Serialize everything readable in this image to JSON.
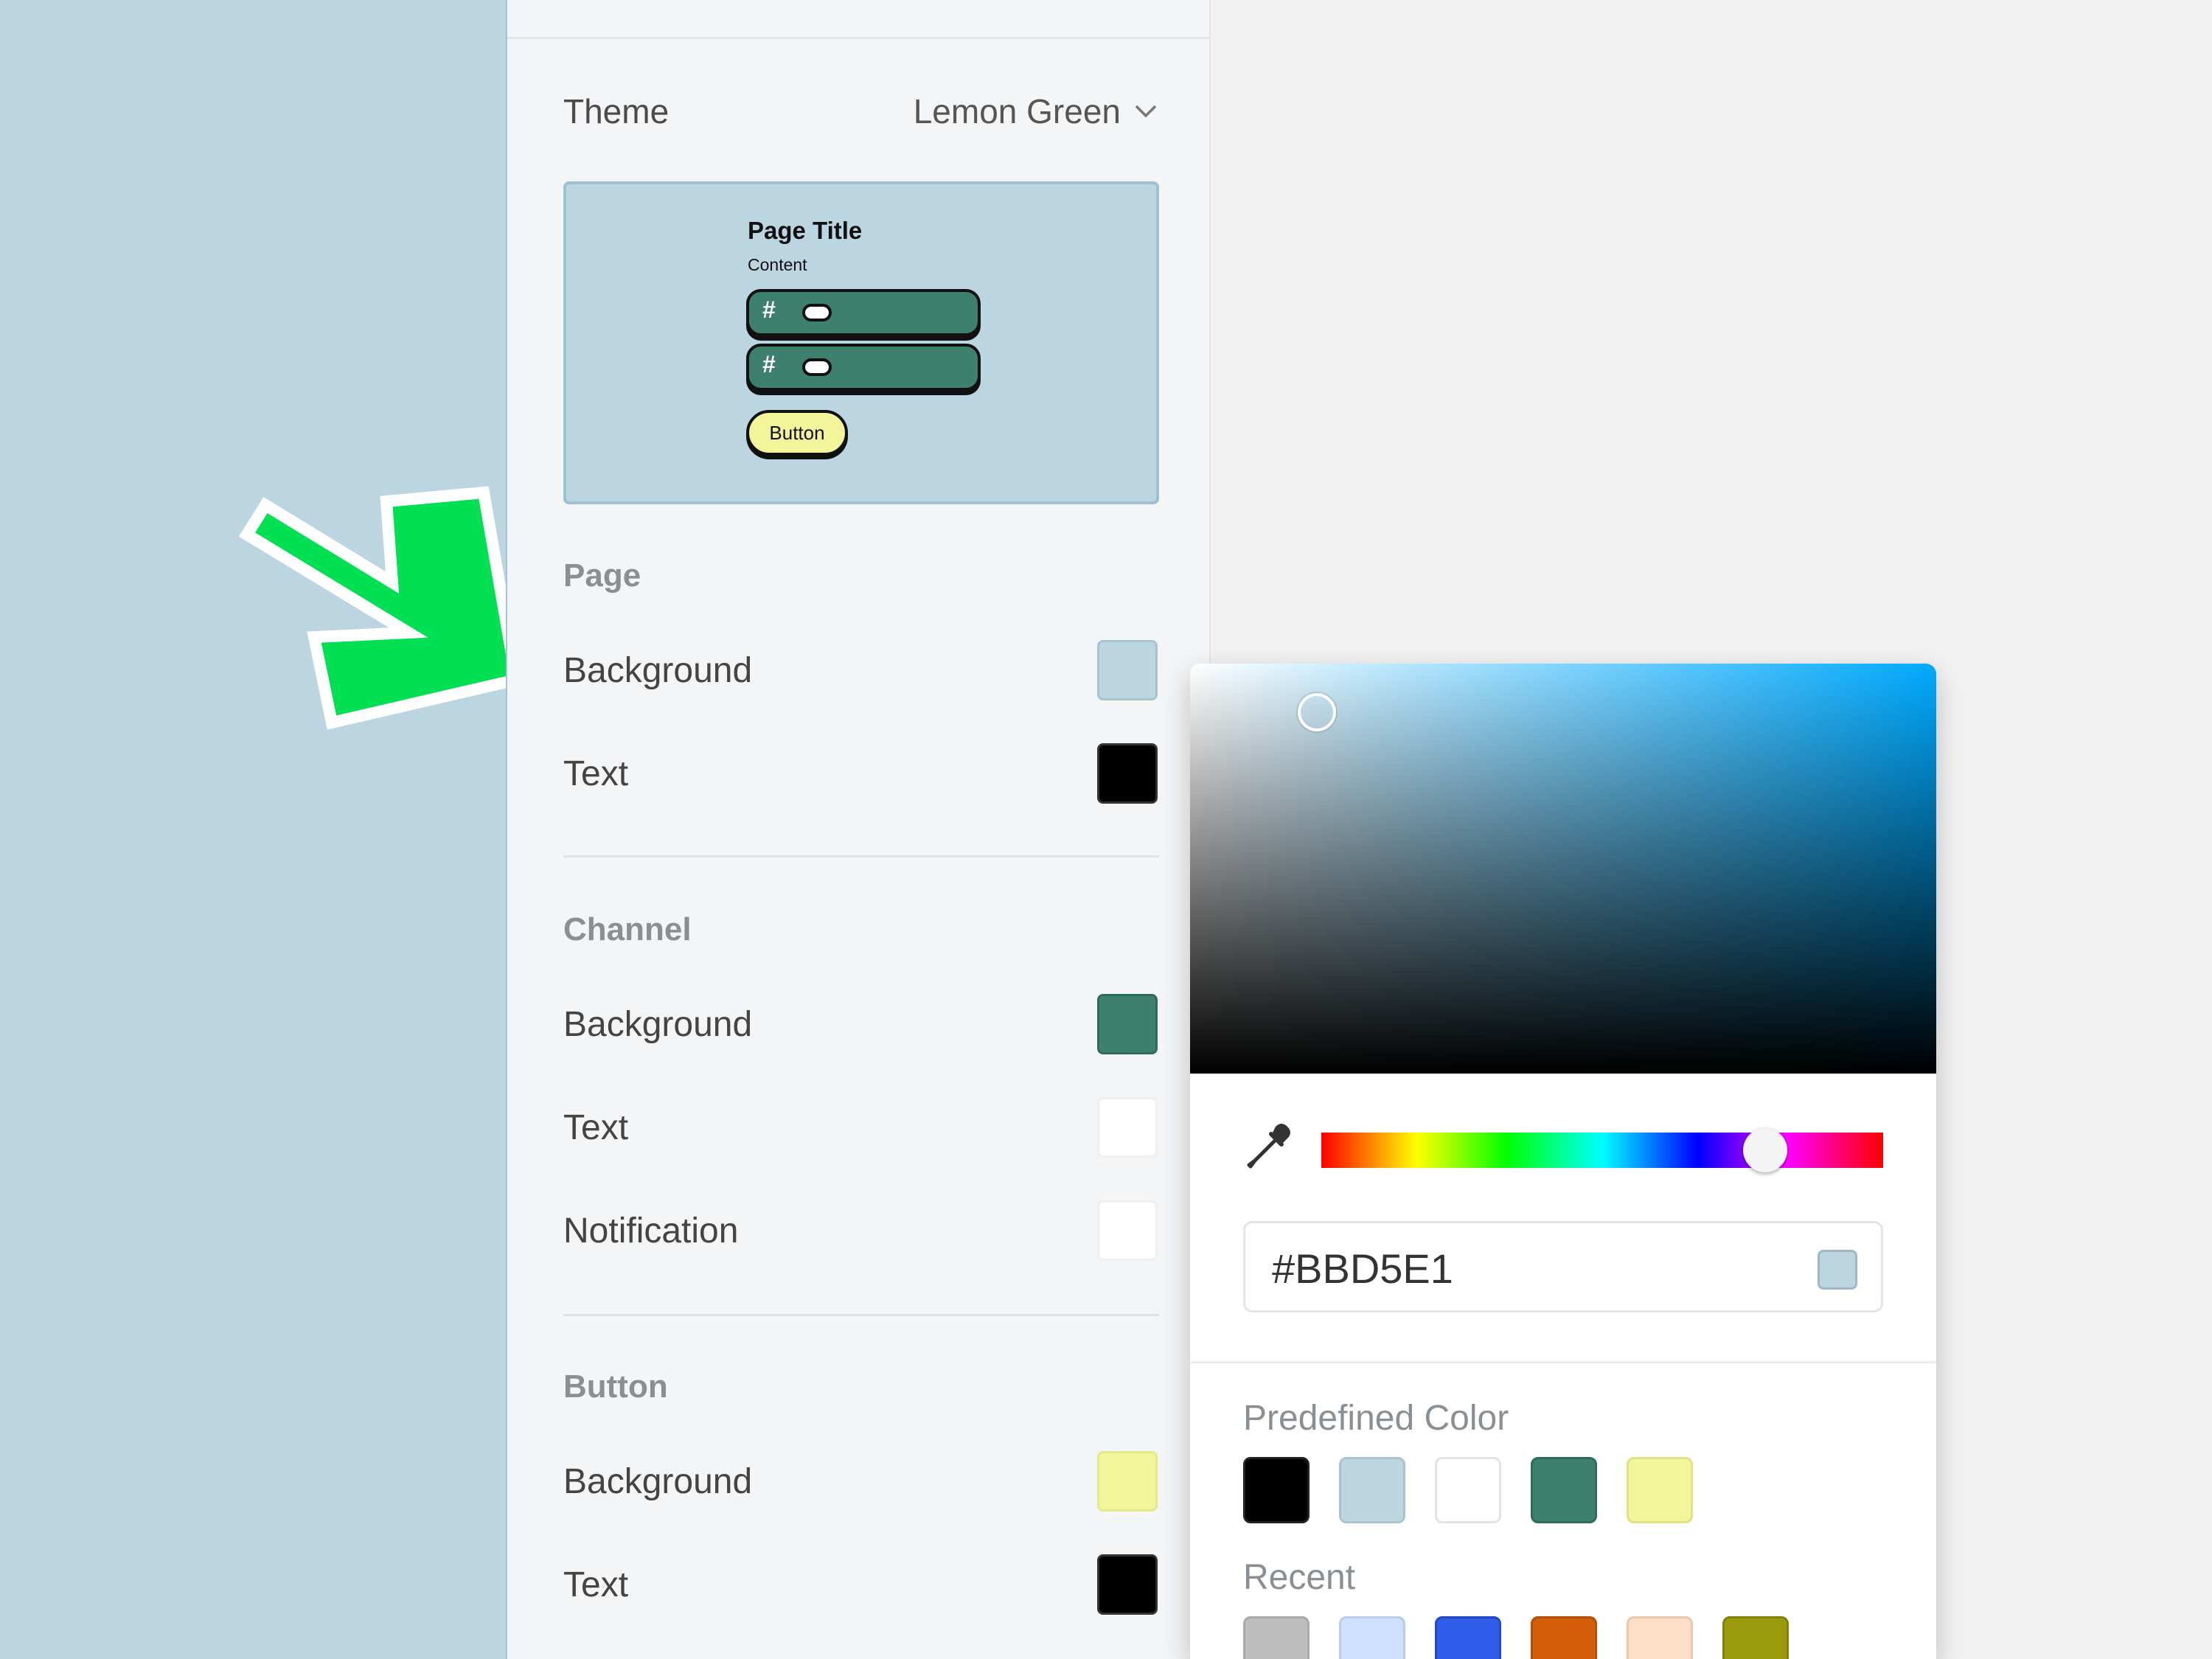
{
  "theme": {
    "label": "Theme",
    "selected": "Lemon Green"
  },
  "preview": {
    "title": "Page Title",
    "content": "Content",
    "hash": "#",
    "button_label": "Button"
  },
  "sections": {
    "page": {
      "title": "Page",
      "background_label": "Background",
      "background_color": "#BBD5E1",
      "text_label": "Text",
      "text_color": "#000000"
    },
    "channel": {
      "title": "Channel",
      "background_label": "Background",
      "background_color": "#3C806D",
      "text_label": "Text",
      "text_color": "#FFFFFF",
      "notification_label": "Notification",
      "notification_color": "#FFFFFF"
    },
    "button": {
      "title": "Button",
      "background_label": "Background",
      "background_color": "#F2F59A",
      "text_label": "Text",
      "text_color": "#000000"
    }
  },
  "picker": {
    "hex_value": "#BBD5E1",
    "predefined_label": "Predefined Color",
    "predefined": [
      "#000000",
      "#BBD5E1",
      "#FFFFFF",
      "#3C806D",
      "#F2F59A"
    ],
    "recent_label": "Recent",
    "recent": [
      "#BDBDBD",
      "#CFE0FF",
      "#2F5CE8",
      "#D35F0A",
      "#FDDFC7",
      "#9A9A0C"
    ]
  },
  "colors": {
    "arrow": "#00E052",
    "panel_bg": "#F3F5F7",
    "left_bg": "#BBD5E1"
  }
}
